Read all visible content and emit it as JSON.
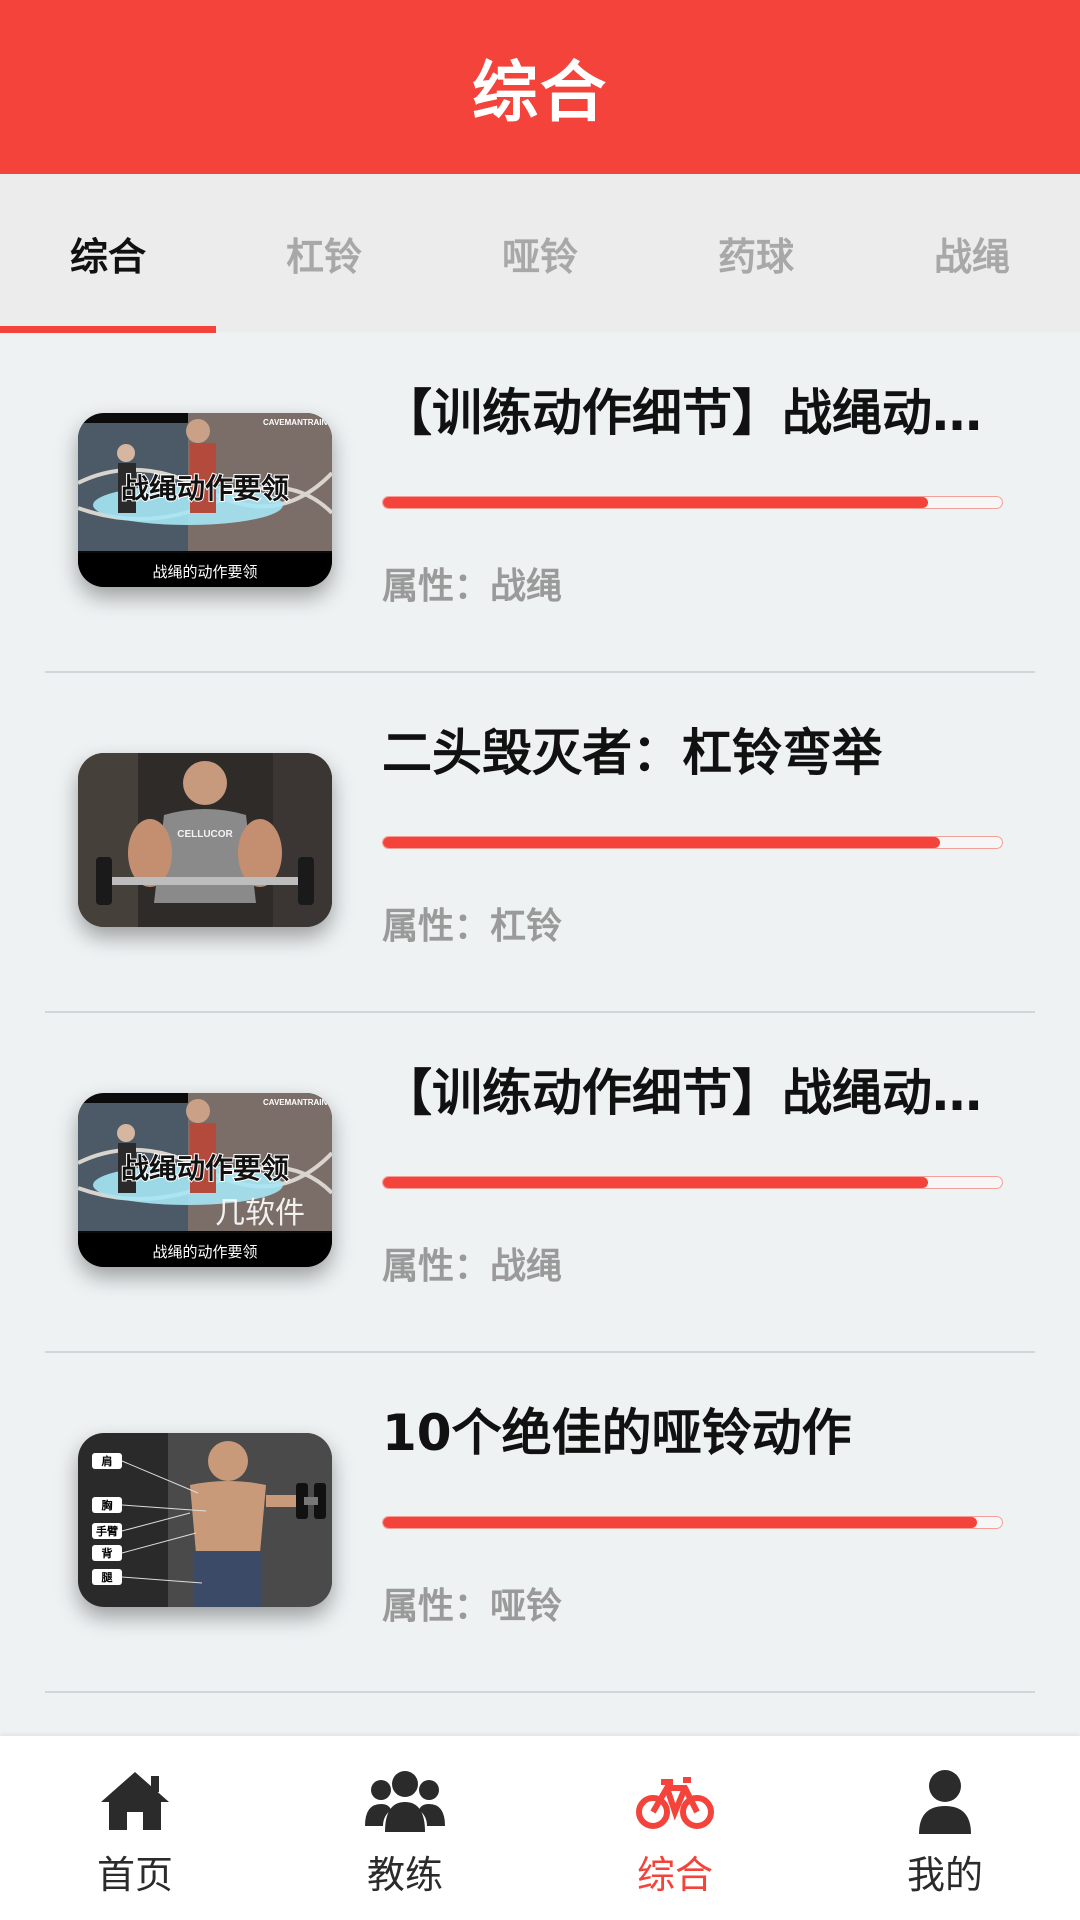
{
  "header": {
    "title": "综合"
  },
  "tabs": [
    {
      "label": "综合",
      "active": true
    },
    {
      "label": "杠铃",
      "active": false
    },
    {
      "label": "哑铃",
      "active": false
    },
    {
      "label": "药球",
      "active": false
    },
    {
      "label": "战绳",
      "active": false
    }
  ],
  "items": [
    {
      "title": "【训练动作细节】战绳动...",
      "attribute": "属性：战绳",
      "progress": 0.88,
      "thumb_caption": "战绳动作要领",
      "thumb_subcaption": "战绳的动作要领",
      "thumb_brand": "CAVEMANTRAINING"
    },
    {
      "title": "二头毁灭者：杠铃弯举",
      "attribute": "属性：杠铃",
      "progress": 0.9,
      "thumb_brand": "CELLUCOR"
    },
    {
      "title": "【训练动作细节】战绳动...",
      "attribute": "属性：战绳",
      "progress": 0.88,
      "thumb_caption": "战绳动作要领",
      "thumb_subcaption": "战绳的动作要领",
      "thumb_brand": "CAVEMANTRAINING"
    },
    {
      "title": "10个绝佳的哑铃动作",
      "attribute": "属性：哑铃",
      "progress": 0.96,
      "thumb_labels": [
        "肩",
        "胸",
        "手臂",
        "背",
        "腿"
      ]
    }
  ],
  "watermark": "几软件",
  "nav": [
    {
      "label": "首页",
      "icon": "home-icon",
      "active": false
    },
    {
      "label": "教练",
      "icon": "users-icon",
      "active": false
    },
    {
      "label": "综合",
      "icon": "bicycle-icon",
      "active": true
    },
    {
      "label": "我的",
      "icon": "user-icon",
      "active": false
    }
  ],
  "colors": {
    "accent": "#f4433a",
    "background": "#eef2f3",
    "tabbar": "#ececec"
  }
}
